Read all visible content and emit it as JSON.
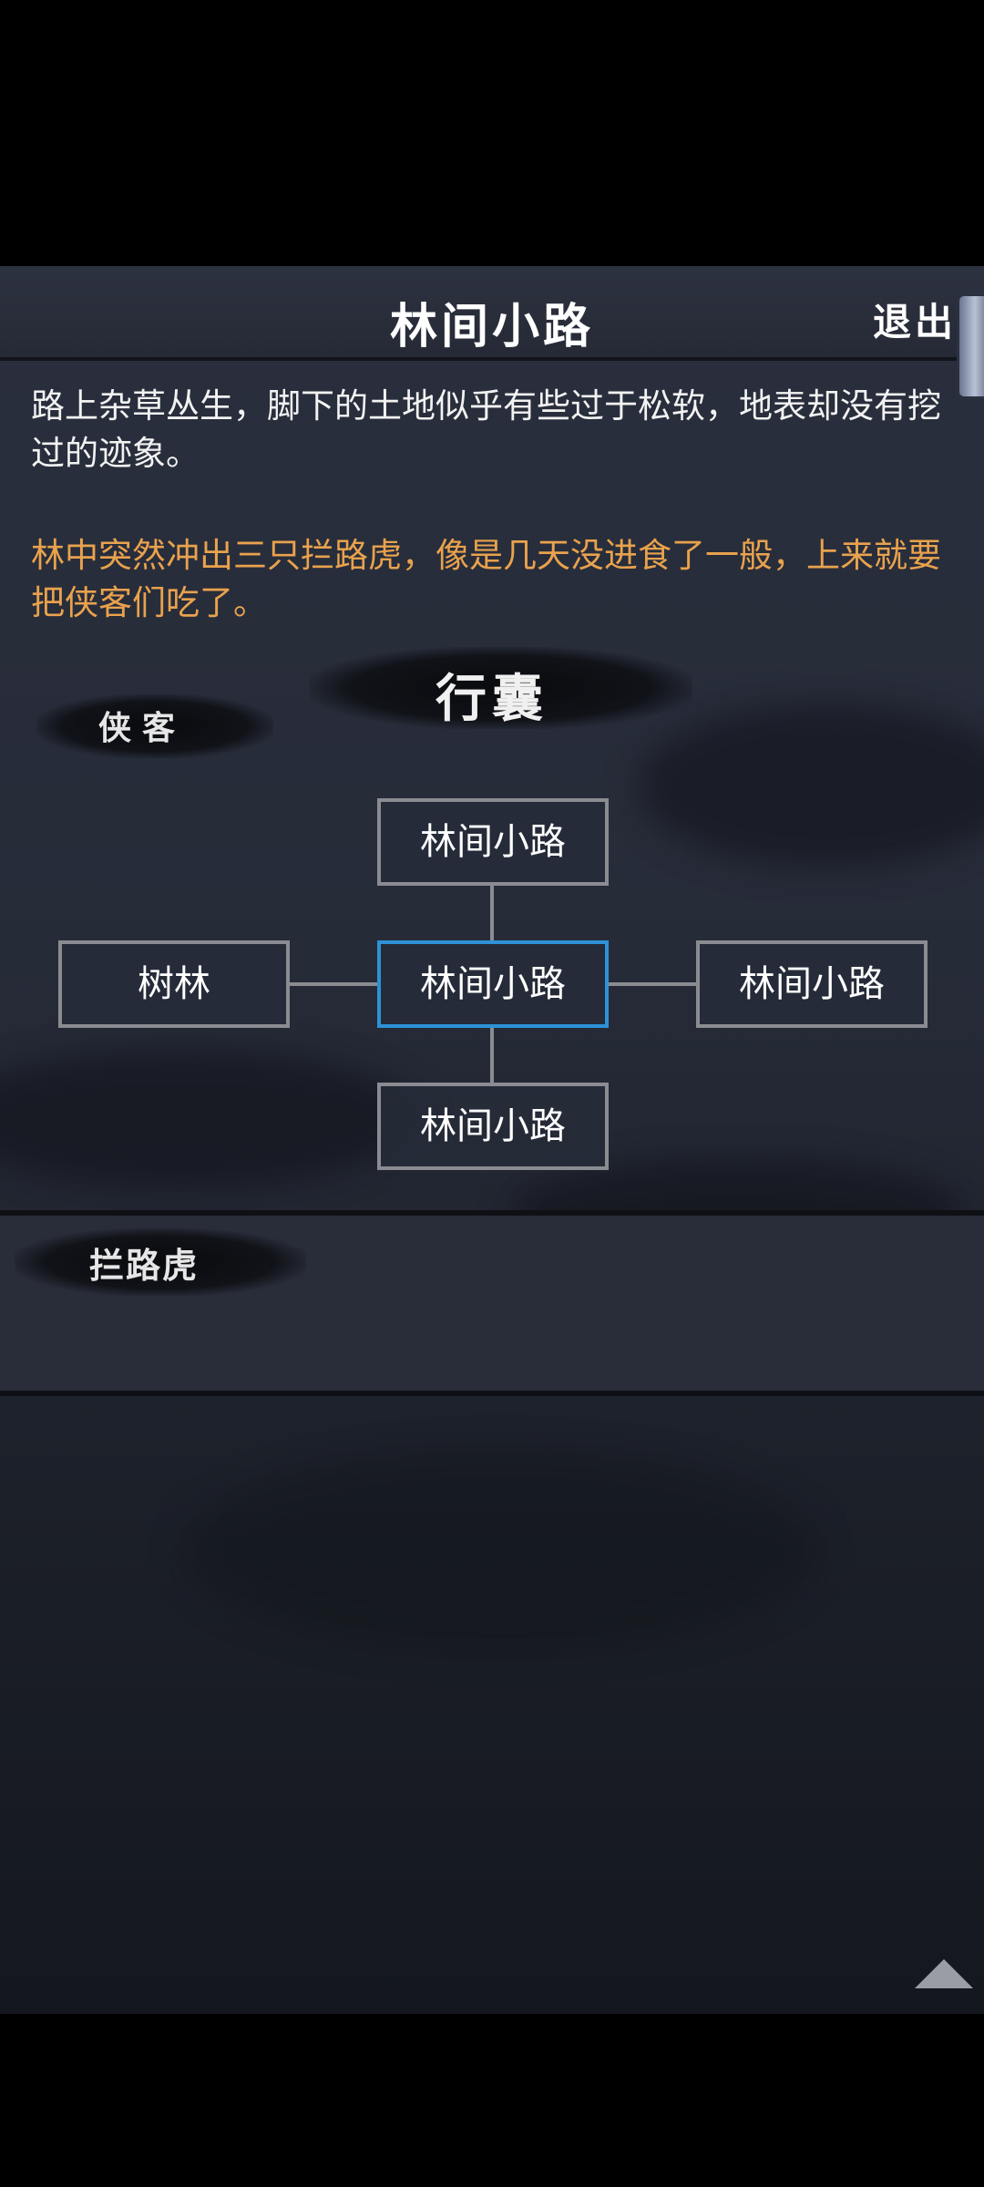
{
  "header": {
    "title": "林间小路",
    "exit_label": "退出"
  },
  "description": {
    "scene": "路上杂草丛生，脚下的土地似乎有些过于松软，地表却没有挖过的迹象。",
    "event": "林中突然冲出三只拦路虎，像是几天没进食了一般，上来就要把侠客们吃了。"
  },
  "labels": {
    "bag": "行囊",
    "heroes": "侠客",
    "enemy": "拦路虎"
  },
  "map": {
    "north": "林间小路",
    "west": "树林",
    "center": "林间小路",
    "east": "林间小路",
    "south": "林间小路"
  },
  "colors": {
    "current_node_border": "#2d92d8",
    "node_border": "#8a8c91",
    "event_text": "#e9a24d",
    "scene_text": "#f2f2f2"
  }
}
